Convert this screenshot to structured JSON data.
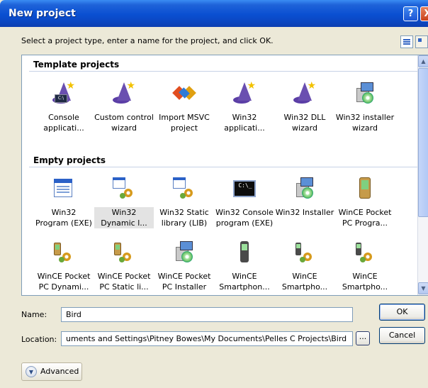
{
  "window": {
    "title": "New project",
    "help_glyph": "?",
    "close_glyph": "X"
  },
  "instruction": "Select a project type, enter a name for the project, and click OK.",
  "view_icons": [
    "list-view-icon",
    "large-icon-view-icon"
  ],
  "groups": [
    {
      "title": "Template projects",
      "items": [
        {
          "label": "Console applicati...",
          "icon": "wizard-console-icon"
        },
        {
          "label": "Custom control wizard",
          "icon": "wizard-icon"
        },
        {
          "label": "Import MSVC project",
          "icon": "msvc-import-icon"
        },
        {
          "label": "Win32 applicati...",
          "icon": "wizard-icon"
        },
        {
          "label": "Win32 DLL wizard",
          "icon": "wizard-icon"
        },
        {
          "label": "Win32 installer wizard",
          "icon": "installer-wizard-icon"
        }
      ]
    },
    {
      "title": "Empty projects",
      "items": [
        {
          "label": "Win32 Program (EXE)",
          "icon": "window-icon"
        },
        {
          "label": "Win32 Dynamic l...",
          "icon": "dll-icon",
          "selected": true
        },
        {
          "label": "Win32 Static library (LIB)",
          "icon": "dll-icon"
        },
        {
          "label": "Win32 Console program (EXE)",
          "icon": "console-icon"
        },
        {
          "label": "Win32 Installer",
          "icon": "installer-icon"
        },
        {
          "label": "WinCE Pocket PC Progra...",
          "icon": "pda-icon"
        },
        {
          "label": "WinCE Pocket PC Dynami...",
          "icon": "pda-dll-icon"
        },
        {
          "label": "WinCE Pocket PC Static li...",
          "icon": "pda-dll-icon"
        },
        {
          "label": "WinCE Pocket PC Installer",
          "icon": "installer-icon"
        },
        {
          "label": "WinCE Smartphon...",
          "icon": "smartphone-icon"
        },
        {
          "label": "WinCE Smartpho...",
          "icon": "smartphone-dll-icon"
        },
        {
          "label": "WinCE Smartpho...",
          "icon": "smartphone-dll-icon"
        }
      ]
    }
  ],
  "scrollbar": {
    "up": "▲",
    "down": "▼"
  },
  "form": {
    "name_label": "Name:",
    "name_value": "Bird",
    "location_label": "Location:",
    "location_value": "uments and Settings\\Pitney Bowes\\My Documents\\Pelles C Projects\\Bird",
    "browse_label": "..."
  },
  "buttons": {
    "ok": "OK",
    "cancel": "Cancel",
    "advanced": "Advanced",
    "advanced_glyph": "▼"
  }
}
